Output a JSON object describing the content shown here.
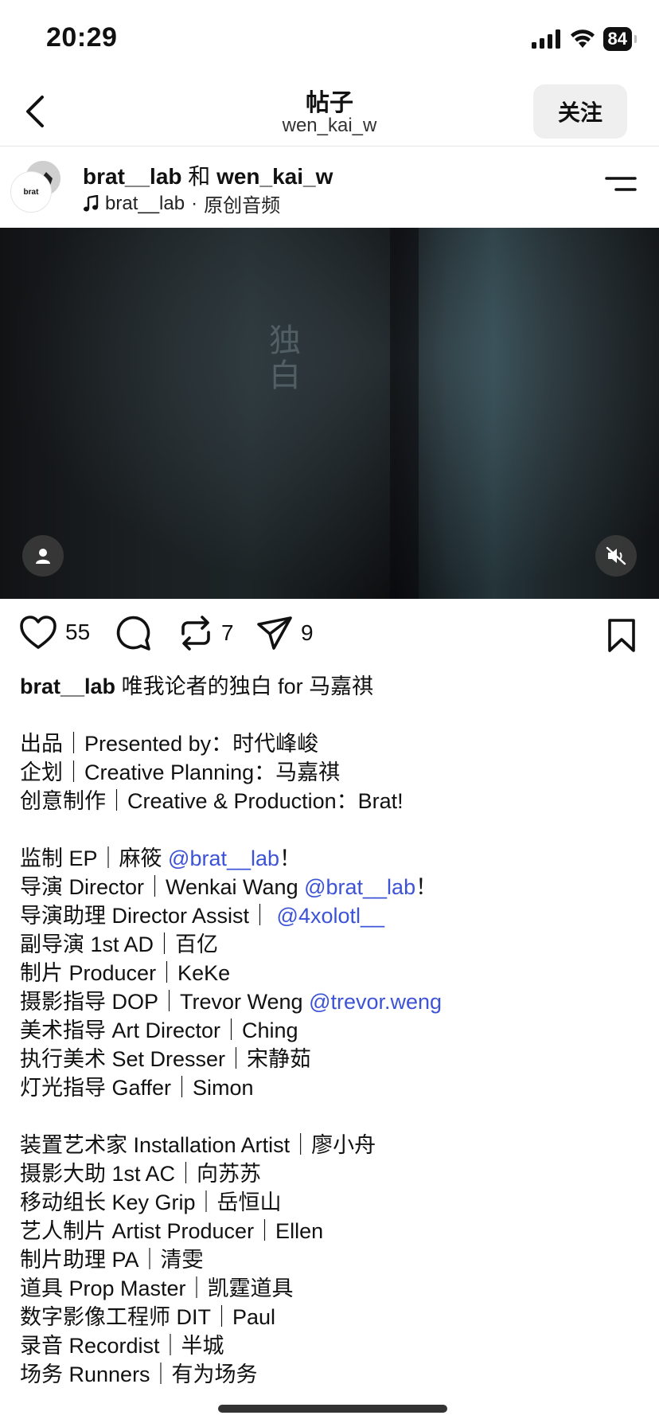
{
  "status_bar": {
    "time": "20:29",
    "battery": "84"
  },
  "nav": {
    "title": "帖子",
    "subtitle": "wen_kai_w",
    "follow_label": "关注"
  },
  "post_header": {
    "author1": "brat__lab",
    "connector": "和",
    "author2": "wen_kai_w",
    "audio_owner": "brat__lab",
    "audio_sep": "·",
    "audio_label": "原创音频",
    "avatar_text": "brat"
  },
  "video": {
    "overlay_text": "独白"
  },
  "actions": {
    "likes": "55",
    "reposts": "7",
    "shares": "9"
  },
  "caption": {
    "username": "brat__lab",
    "title": "唯我论者的独白 for 马嘉祺",
    "block1": [
      "出品｜Presented by：时代峰峻",
      "企划｜Creative Planning：马嘉祺",
      "创意制作｜Creative & Production：Brat!"
    ],
    "ep_prefix": "监制 EP｜麻筱 ",
    "ep_mention": "@brat__lab",
    "ep_suffix": "！",
    "director_prefix": "导演 Director｜Wenkai Wang ",
    "director_mention": "@brat__lab",
    "director_suffix": "！",
    "assist_prefix": "导演助理 Director Assist｜ ",
    "assist_mention": "@4xolotl__",
    "ad": "副导演 1st AD｜百亿",
    "producer": "制片 Producer｜KeKe",
    "dop_prefix": "摄影指导 DOP｜Trevor Weng ",
    "dop_mention": "@trevor.weng",
    "block2_rest": [
      "美术指导 Art Director｜Ching",
      "执行美术 Set Dresser｜宋静茹",
      "灯光指导 Gaffer｜Simon"
    ],
    "block3": [
      "装置艺术家 Installation Artist｜廖小舟",
      "摄影大助 1st AC｜向苏苏",
      "移动组长 Key Grip｜岳恒山",
      "艺人制片 Artist Producer｜Ellen",
      "制片助理 PA｜清雯",
      "道具 Prop Master｜凯霆道具",
      "数字影像工程师 DIT｜Paul",
      "录音 Recordist｜半城",
      "场务 Runners｜有为场务"
    ]
  }
}
